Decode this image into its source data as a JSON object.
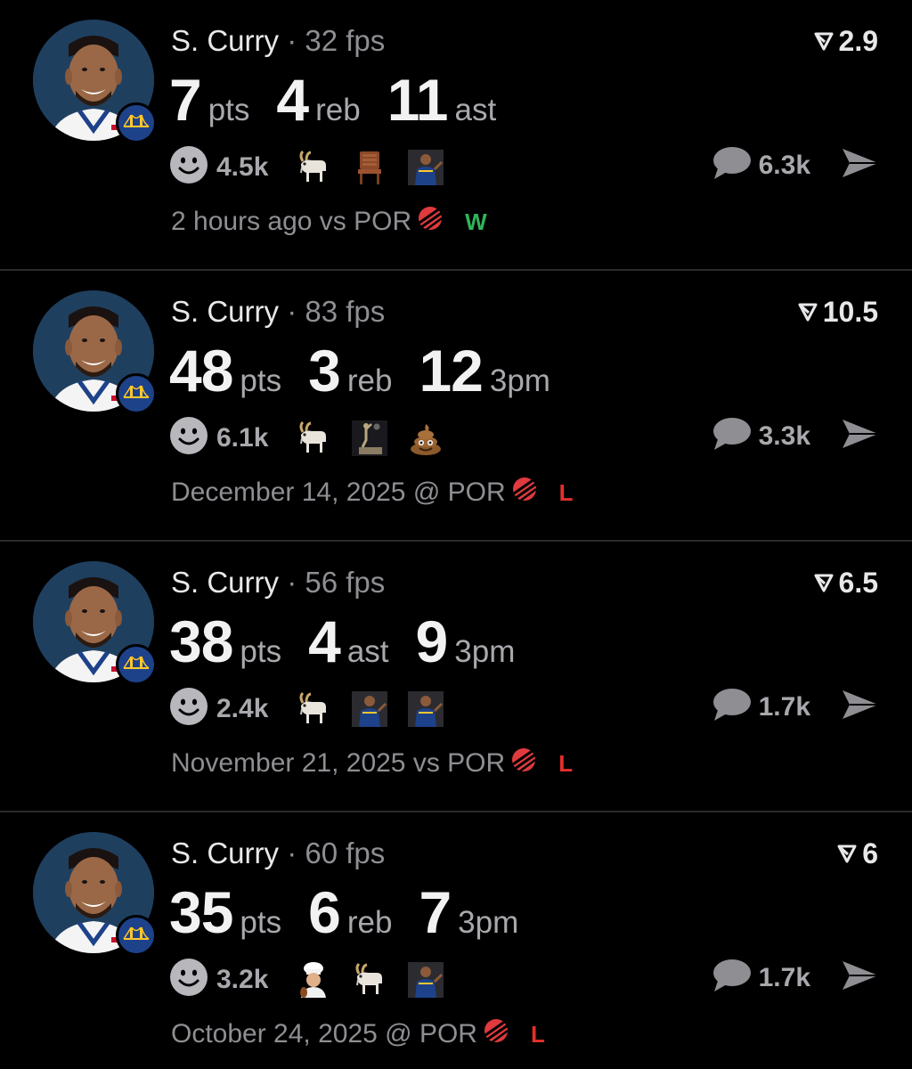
{
  "posts": [
    {
      "player": "S. Curry",
      "separator": "·",
      "fps": "32 fps",
      "score": "2.9",
      "stats": [
        {
          "value": "7",
          "label": "pts"
        },
        {
          "value": "4",
          "label": "reb"
        },
        {
          "value": "11",
          "label": "ast"
        }
      ],
      "reaction_count": "4.5k",
      "emojis": [
        "goat-emoji",
        "chair-emoji",
        "player-emoji"
      ],
      "comment_count": "6.3k",
      "timestamp": "2 hours ago vs POR",
      "result": "W",
      "result_color": "#30b45a"
    },
    {
      "player": "S. Curry",
      "separator": "·",
      "fps": "83 fps",
      "score": "10.5",
      "stats": [
        {
          "value": "48",
          "label": "pts"
        },
        {
          "value": "3",
          "label": "reb"
        },
        {
          "value": "12",
          "label": "3pm"
        }
      ],
      "reaction_count": "6.1k",
      "emojis": [
        "goat-emoji",
        "statue-emoji",
        "poop-emoji"
      ],
      "comment_count": "3.3k",
      "timestamp": "December 14, 2025 @ POR",
      "result": "L",
      "result_color": "#e5302b"
    },
    {
      "player": "S. Curry",
      "separator": "·",
      "fps": "56 fps",
      "score": "6.5",
      "stats": [
        {
          "value": "38",
          "label": "pts"
        },
        {
          "value": "4",
          "label": "ast"
        },
        {
          "value": "9",
          "label": "3pm"
        }
      ],
      "reaction_count": "2.4k",
      "emojis": [
        "goat-emoji",
        "player-emoji",
        "player-emoji"
      ],
      "comment_count": "1.7k",
      "timestamp": "November 21, 2025 vs POR",
      "result": "L",
      "result_color": "#e5302b"
    },
    {
      "player": "S. Curry",
      "separator": "·",
      "fps": "60 fps",
      "score": "6",
      "stats": [
        {
          "value": "35",
          "label": "pts"
        },
        {
          "value": "6",
          "label": "reb"
        },
        {
          "value": "7",
          "label": "3pm"
        }
      ],
      "reaction_count": "3.2k",
      "emojis": [
        "chef-emoji",
        "goat-emoji",
        "player-emoji"
      ],
      "comment_count": "1.7k",
      "timestamp": "October 24, 2025 @ POR",
      "result": "L",
      "result_color": "#e5302b"
    }
  ],
  "colors": {
    "background": "#000000",
    "text_primary": "#f2f2f2",
    "text_secondary": "#8e8e93",
    "win": "#30b45a",
    "loss": "#e5302b"
  }
}
